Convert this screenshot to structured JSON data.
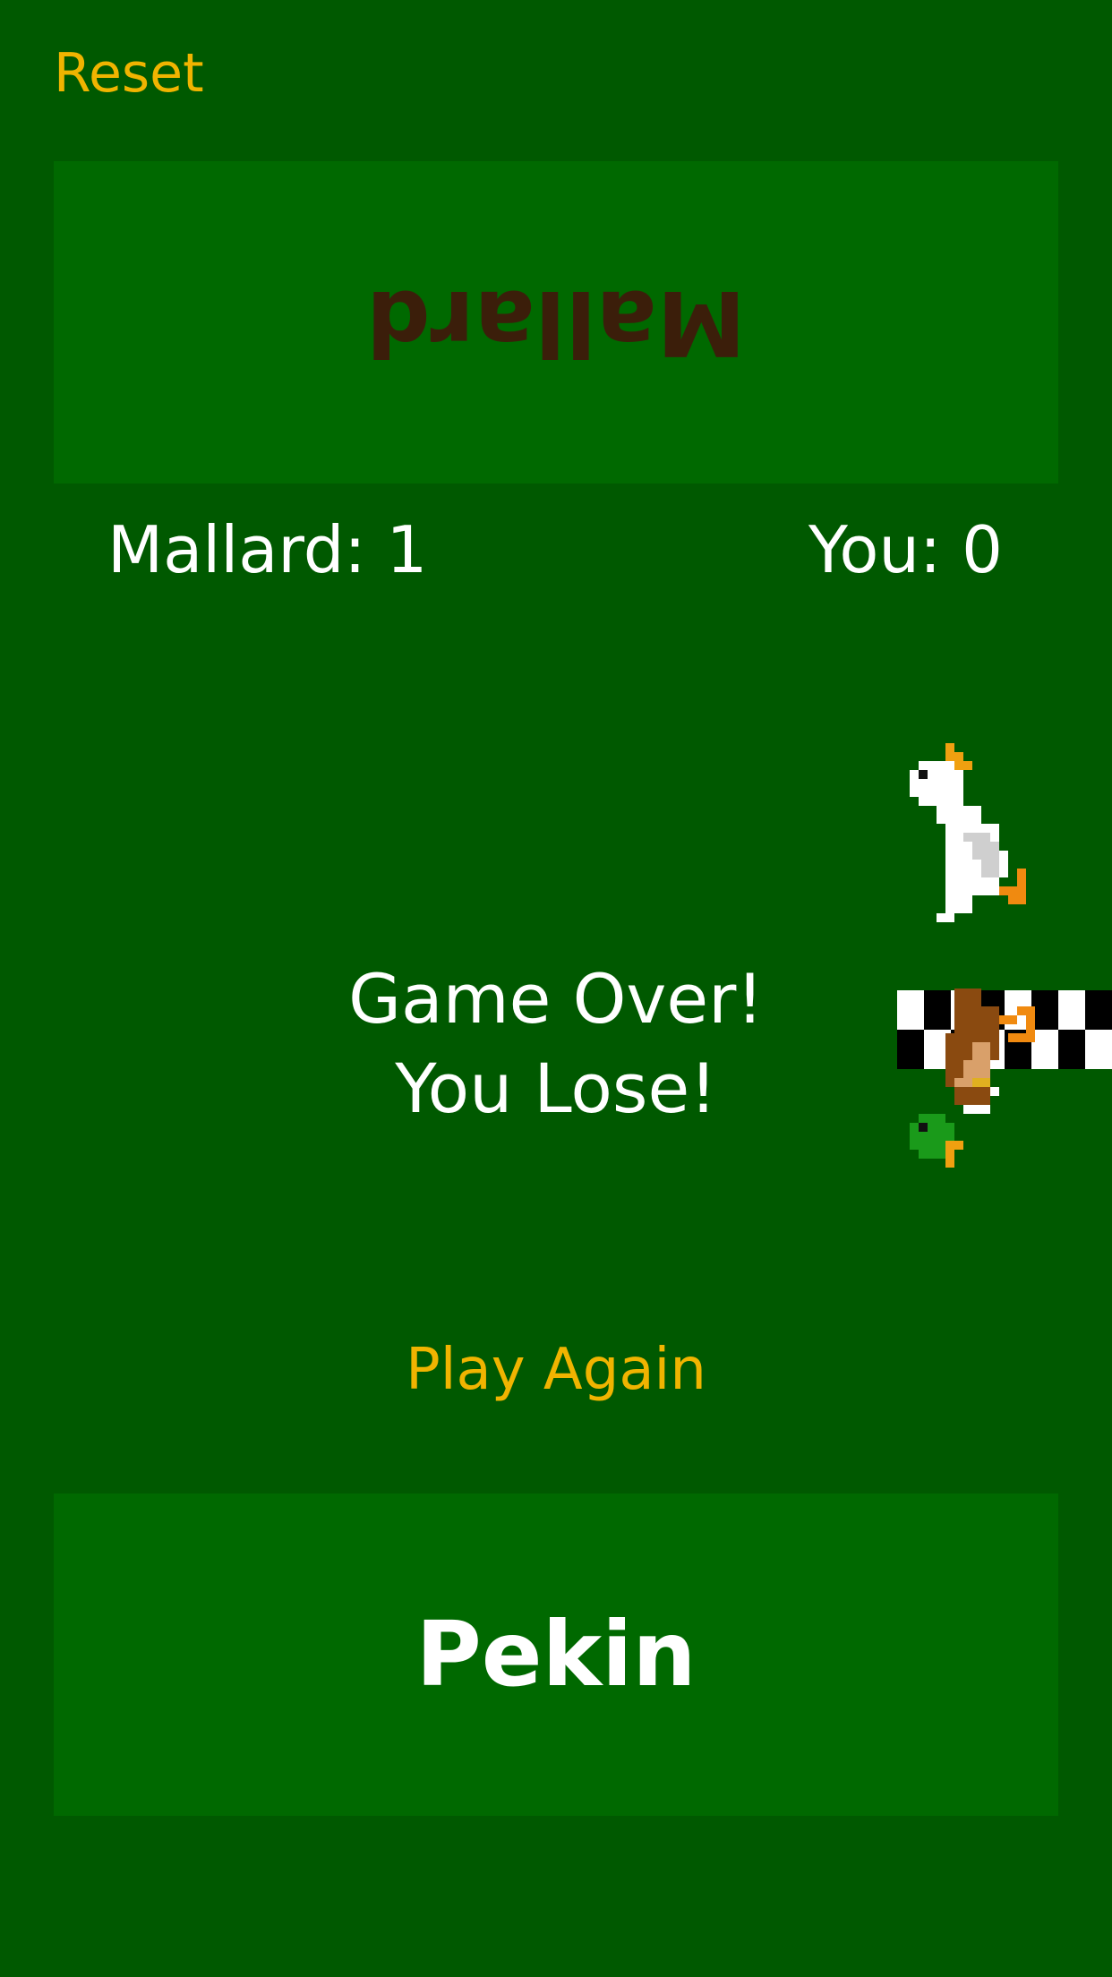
{
  "header": {
    "reset_label": "Reset"
  },
  "opponent": {
    "name": "Mallard"
  },
  "scores": {
    "opponent": "Mallard: 1",
    "player": "You: 0"
  },
  "message": {
    "line1": "Game Over!",
    "line2": "You Lose!"
  },
  "actions": {
    "play_again": "Play Again"
  },
  "player": {
    "name": "Pekin"
  },
  "colors": {
    "background": "#005900",
    "panel": "#006900",
    "accent": "#f0b400",
    "opponent_text": "#3b1e0a",
    "text": "#ffffff"
  },
  "icons": {
    "pekin": "pekin-duck-icon",
    "mallard": "mallard-duck-icon",
    "finish": "finish-line-flag-icon"
  }
}
